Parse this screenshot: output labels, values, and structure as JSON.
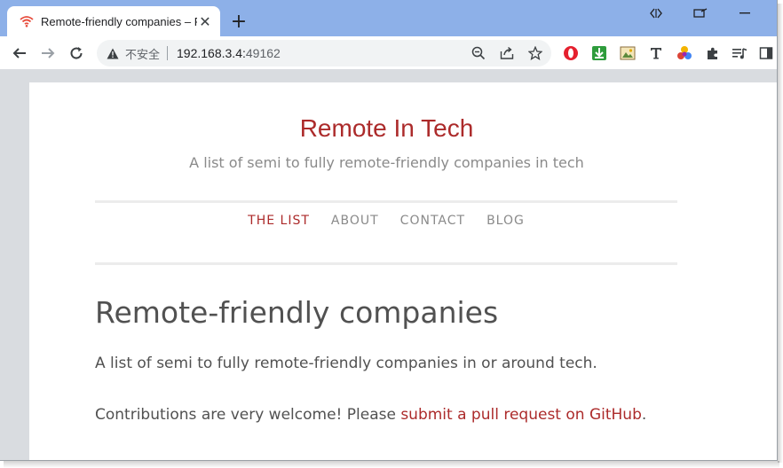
{
  "browser": {
    "tab_title": "Remote-friendly companies – R",
    "new_tab_label": "+",
    "security_label": "不安全",
    "url_host": "192.168.3.4:",
    "url_port": "49162"
  },
  "icons": {
    "tab_favicon": "wifi-icon",
    "tab_close": "close-icon",
    "back": "arrow-left-icon",
    "forward": "arrow-right-icon",
    "reload": "reload-icon",
    "warning": "warning-icon",
    "zoom": "zoom-icon",
    "share": "share-icon",
    "bookmark": "star-icon",
    "extensions": [
      "opera-icon",
      "download-icon",
      "image-icon",
      "text-t-icon",
      "colorful-dots-icon",
      "puzzle-icon",
      "playlist-icon",
      "side-panel-icon"
    ]
  },
  "site": {
    "title": "Remote In Tech",
    "tagline": "A list of semi to fully remote-friendly companies in tech",
    "nav": [
      {
        "label": "THE LIST",
        "active": true
      },
      {
        "label": "ABOUT",
        "active": false
      },
      {
        "label": "CONTACT",
        "active": false
      },
      {
        "label": "BLOG",
        "active": false
      }
    ]
  },
  "content": {
    "heading": "Remote-friendly companies",
    "intro": "A list of semi to fully remote-friendly companies in or around tech.",
    "contrib_text": "Contributions are very welcome! Please ",
    "contrib_link": "submit a pull request on GitHub",
    "contrib_end": "."
  },
  "colors": {
    "accent": "#ac2b2b",
    "tab_strip": "#8db0e8",
    "body_text": "#515151",
    "muted_text": "#8a8a8a"
  }
}
